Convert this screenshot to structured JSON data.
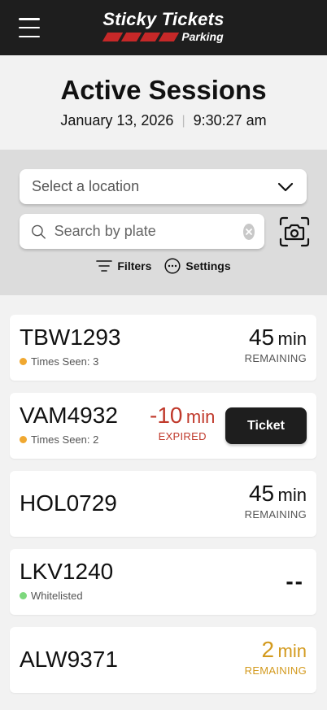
{
  "header": {
    "logo_line1": "Sticky Tickets",
    "logo_line2": "Parking"
  },
  "title": "Active Sessions",
  "date": "January 13, 2026",
  "date_separator": "|",
  "time": "9:30:27 am",
  "controls": {
    "location_placeholder": "Select a location",
    "search_placeholder": "Search by plate",
    "filters_label": "Filters",
    "settings_label": "Settings"
  },
  "sessions": [
    {
      "plate": "TBW1293",
      "meta": "Times Seen: 3",
      "meta_color": "#f0a830",
      "value": "45",
      "unit": "min",
      "label": "REMAINING",
      "color": "#111111",
      "label_color": "#555555"
    },
    {
      "plate": "VAM4932",
      "meta": "Times Seen: 2",
      "meta_color": "#f0a830",
      "value": "-10",
      "unit": "min",
      "label": "EXPIRED",
      "color": "#c0392b",
      "label_color": "#c0392b",
      "action": "Ticket"
    },
    {
      "plate": "HOL0729",
      "value": "45",
      "unit": "min",
      "label": "REMAINING",
      "color": "#111111",
      "label_color": "#555555"
    },
    {
      "plate": "LKV1240",
      "meta": "Whitelisted",
      "meta_color": "#7dd87d",
      "value": "--"
    },
    {
      "plate": "ALW9371",
      "value": "2",
      "unit": "min",
      "label": "REMAINING",
      "color": "#d39a1e",
      "label_color": "#d39a1e"
    }
  ],
  "colors": {
    "header_bg": "#1e1e1e",
    "brand_red": "#c62828",
    "controls_bg": "#dcdcdc",
    "page_bg": "#f2f2f2"
  }
}
